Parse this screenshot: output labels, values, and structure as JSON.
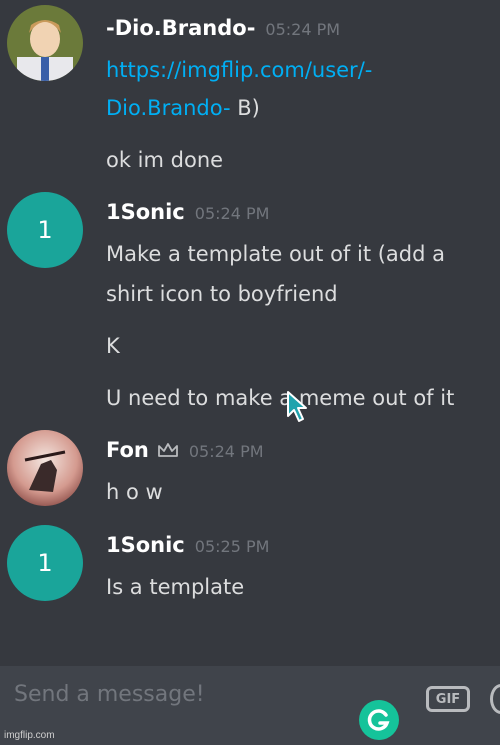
{
  "messages": [
    {
      "author": "-Dio.Brando-",
      "time": "05:24 PM",
      "lines": [
        {
          "link_part1": "https://imgflip.com/user/-",
          "link_part2": "Dio.Brando-",
          "suffix": " B)"
        },
        {
          "text": "ok im done"
        }
      ]
    },
    {
      "author": "1Sonic",
      "avatar_text": "1",
      "time": "05:24 PM",
      "lines": [
        "Make a template out of it (add a",
        "shirt icon to boyfriend",
        "K",
        "U need to make a meme out of it"
      ]
    },
    {
      "author": "Fon",
      "time": "05:24 PM",
      "lines": [
        "h o w"
      ]
    },
    {
      "author": "1Sonic",
      "avatar_text": "1",
      "time": "05:25 PM",
      "lines": [
        "Is a template"
      ]
    }
  ],
  "composer": {
    "placeholder": "Send a message!",
    "gif_label": "GIF"
  },
  "watermark": "imgflip.com",
  "colors": {
    "background": "#36393f",
    "composer": "#40444b",
    "link": "#00aff4",
    "avatar_teal": "#1aa59a",
    "grammarly": "#15c39a"
  }
}
